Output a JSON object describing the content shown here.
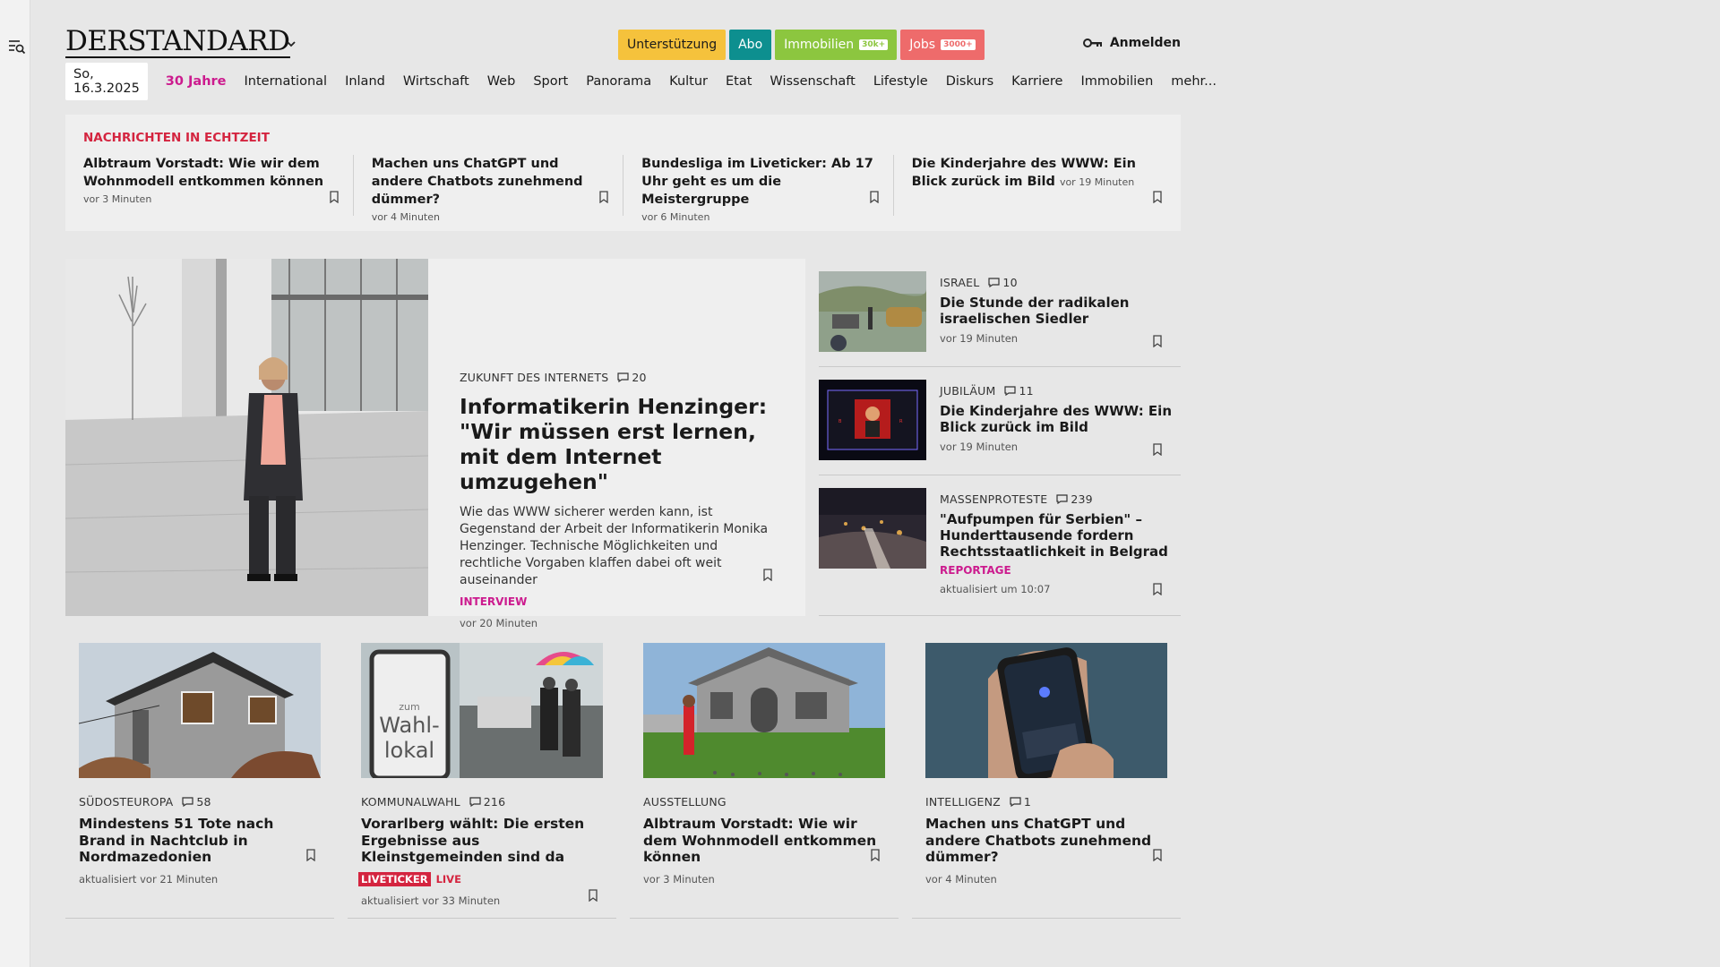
{
  "header": {
    "logo_text": "DERSTANDARD",
    "pills": [
      {
        "label": "Unterstützung",
        "badge": "",
        "bg": "#f5c23c",
        "fg": "#1a1a1a"
      },
      {
        "label": "Abo",
        "badge": "",
        "bg": "#0d8f8f",
        "fg": "#ffffff"
      },
      {
        "label": "Immobilien",
        "badge": "30k+",
        "bg": "#8cc63f",
        "fg": "#ffffff"
      },
      {
        "label": "Jobs",
        "badge": "3000+",
        "bg": "#ee6b6b",
        "fg": "#ffffff"
      }
    ],
    "login_label": "Anmelden"
  },
  "nav": {
    "date": "So, 16.3.2025",
    "items": [
      "30 Jahre",
      "International",
      "Inland",
      "Wirtschaft",
      "Web",
      "Sport",
      "Panorama",
      "Kultur",
      "Etat",
      "Wissenschaft",
      "Lifestyle",
      "Diskurs",
      "Karriere",
      "Immobilien",
      "mehr..."
    ],
    "accent_color": "#cc1b8e"
  },
  "realtime": {
    "title": "NACHRICHTEN IN ECHTZEIT",
    "items": [
      {
        "headline": "Albtraum Vorstadt: Wie wir dem Wohnmodell entkommen können",
        "time": "vor 3 Minuten"
      },
      {
        "headline": "Machen uns ChatGPT und andere Chatbots zunehmend dümmer?",
        "time": "vor 4 Minuten"
      },
      {
        "headline": "Bundesliga im Liveticker: Ab 17 Uhr geht es um die Meistergruppe",
        "time": "vor 6 Minuten"
      },
      {
        "headline": "Die Kinderjahre des WWW: Ein Blick zurück im Bild",
        "time": "vor 19 Minuten"
      }
    ]
  },
  "hero": {
    "kicker": "ZUKUNFT DES INTERNETS",
    "comments": "20",
    "title": "Informatikerin Henzinger: \"Wir müssen erst lernen, mit dem Internet umzugehen\"",
    "lead": "Wie das WWW sicherer werden kann, ist Gegenstand der Arbeit der Informatikerin Monika Henzinger. Technische Möglichkeiten und rechtliche Vorgaben klaffen dabei oft weit auseinander",
    "tag": "INTERVIEW",
    "time": "vor 20 Minuten"
  },
  "side": [
    {
      "kicker": "ISRAEL",
      "comments": "10",
      "title": "Die Stunde der radikalen israelischen Siedler",
      "tag": "",
      "time": "vor 19 Minuten"
    },
    {
      "kicker": "JUBILÄUM",
      "comments": "11",
      "title": "Die Kinderjahre des WWW: Ein Blick zurück im Bild",
      "tag": "",
      "time": "vor 19 Minuten"
    },
    {
      "kicker": "MASSENPROTESTE",
      "comments": "239",
      "title": "\"Aufpumpen für Serbien\" – Hunderttausende fordern Rechtsstaatlichkeit in Belgrad",
      "tag": "REPORTAGE",
      "time": "aktualisiert um 10:07"
    }
  ],
  "cards": [
    {
      "kicker": "SÜDOSTEUROPA",
      "comments": "58",
      "title": "Mindestens 51 Tote nach Brand in Nachtclub in Nordmazedonien",
      "time": "aktualisiert vor 21 Minuten"
    },
    {
      "kicker": "KOMMUNALWAHL",
      "comments": "216",
      "title": "Vorarlberg wählt: Die ersten Ergebnisse aus Kleinstgemeinden sind da",
      "liveticker": "LIVETICKER",
      "live": "LIVE",
      "time": "aktualisiert vor 33 Minuten"
    },
    {
      "kicker": "AUSSTELLUNG",
      "comments": "",
      "title": "Albtraum Vorstadt: Wie wir dem Wohnmodell entkommen können",
      "time": "vor 3 Minuten"
    },
    {
      "kicker": "INTELLIGENZ",
      "comments": "1",
      "title": "Machen uns ChatGPT und andere Chatbots zunehmend dümmer?",
      "time": "vor 4 Minuten"
    }
  ],
  "images": {
    "card2_sign": "zum Wahl-lokal"
  }
}
